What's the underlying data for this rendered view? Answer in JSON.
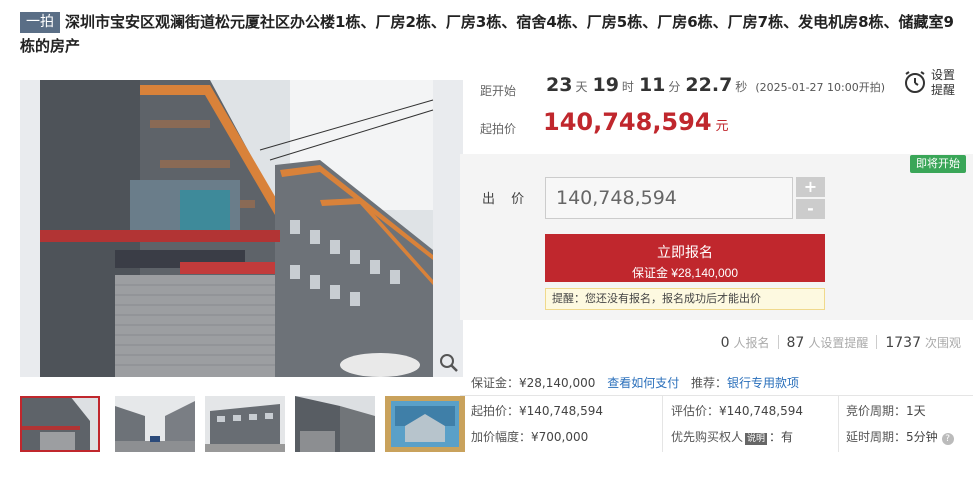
{
  "title": {
    "badge": "一拍",
    "text": "深圳市宝安区观澜街道松元厦社区办公楼1栋、厂房2栋、厂房3栋、宿舍4栋、厂房5栋、厂房6栋、厂房7栋、发电机房8栋、储藏室9栋的房产"
  },
  "countdown": {
    "label": "距开始",
    "days": "23",
    "days_unit": "天",
    "hours": "19",
    "hours_unit": "时",
    "minutes": "11",
    "minutes_unit": "分",
    "seconds": "22.7",
    "seconds_unit": "秒",
    "start_note": "(2025-01-27 10:00开拍)"
  },
  "remind": {
    "label": "设置提醒",
    "icon": "alarm-clock-icon"
  },
  "start_price": {
    "label": "起拍价",
    "value": "140,748,594",
    "unit": "元"
  },
  "status_tag": "即将开始",
  "bid": {
    "label": "出 价",
    "input_value": "140,748,594",
    "plus": "+",
    "minus": "-"
  },
  "signup": {
    "label": "立即报名",
    "deposit": "保证金 ¥28,140,000"
  },
  "tip": "提醒：您还没有报名，报名成功后才能出价",
  "stats": {
    "signed_count": "0",
    "signed_label": "人报名",
    "remind_count": "87",
    "remind_label": "人设置提醒",
    "views_count": "1737",
    "views_label": "次围观"
  },
  "details": {
    "deposit_label": "保证金：",
    "deposit_value": "¥28,140,000",
    "how_to_pay": "查看如何支付",
    "recommend_label": "推荐：",
    "recommend_link": "银行专用款项",
    "start_price_label": "起拍价：",
    "start_price_value": "¥140,748,594",
    "appraisal_label": "评估价：",
    "appraisal_value": "¥140,748,594",
    "bid_period_label": "竞价周期：",
    "bid_period_value": "1天",
    "increment_label": "加价幅度：",
    "increment_value": "¥700,000",
    "priority_label": "优先购买权人",
    "priority_badge": "说明",
    "priority_value": "：有",
    "delay_label": "延时周期：",
    "delay_value": "5分钟",
    "help": "?"
  },
  "colors": {
    "accent_red": "#c0272d",
    "link_blue": "#2a6fbb",
    "status_green": "#3aa658",
    "badge_slate": "#5a6e86"
  }
}
